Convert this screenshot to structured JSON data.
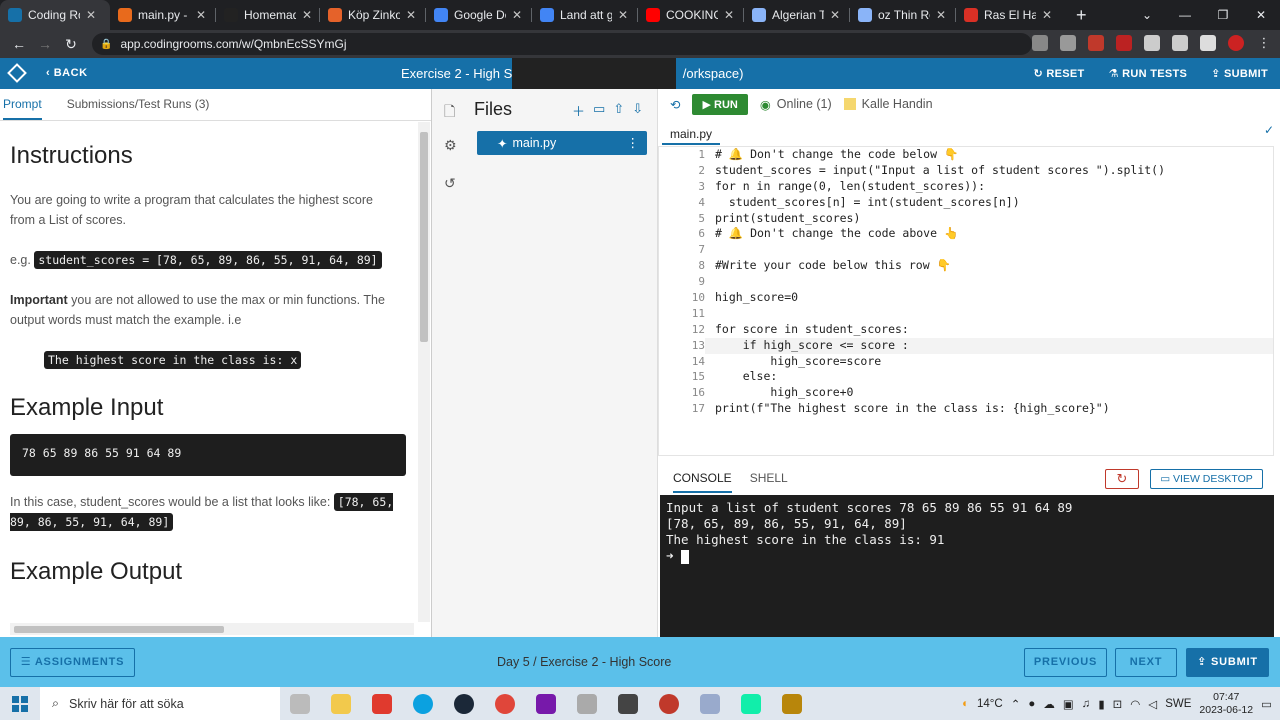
{
  "browser": {
    "tabs": [
      {
        "title": "Coding Ro...",
        "color": "#1670a8",
        "active": true
      },
      {
        "title": "main.py - p...",
        "color": "#e86a1c"
      },
      {
        "title": "Homemade...",
        "color": "#222222"
      },
      {
        "title": "Köp Zinkox...",
        "color": "#e5622a"
      },
      {
        "title": "Google Dok...",
        "color": "#4285f4"
      },
      {
        "title": "Land att gö...",
        "color": "#4285f4"
      },
      {
        "title": "COOKING /...",
        "color": "#ff0000"
      },
      {
        "title": "Algerian Th...",
        "color": "#8ab4f8"
      },
      {
        "title": "oz Thin Ro...",
        "color": "#8ab4f8"
      },
      {
        "title": "Ras El Han...",
        "color": "#d93025"
      }
    ],
    "new_tab": "+",
    "url": "app.codingrooms.com/w/QmbnEcSSYmGj"
  },
  "app_header": {
    "back": "BACK",
    "title": "Exercise 2 - High Sc",
    "title_tail": "/orkspace)",
    "reset": "RESET",
    "run_tests": "RUN TESTS",
    "submit": "SUBMIT"
  },
  "left_panel": {
    "tabs": [
      "Prompt",
      "Submissions/Test Runs (3)"
    ],
    "instructions_title": "Instructions",
    "intro": "You are going to write a program that calculates the highest score from a List of scores.",
    "eg_prefix": "e.g.",
    "eg_code": "student_scores = [78, 65, 89, 86, 55, 91, 64, 89]",
    "important_bold": "Important",
    "important_rest": " you are not allowed to use the max or min functions. The output words must match the example. i.e",
    "output_example": "The highest score in the class is: x",
    "example_input_title": "Example Input",
    "example_input": "78 65 89 86 55 91 64 89",
    "case_text": "In this case, student_scores would be a list that looks like: ",
    "case_code": "[78, 65, 89, 86, 55, 91, 64, 89]",
    "example_output_title": "Example Output"
  },
  "files": {
    "title": "Files",
    "file": "main.py"
  },
  "editor": {
    "run": "RUN",
    "online": "Online (1)",
    "user": "Kalle Handin",
    "tab": "main.py",
    "lines": [
      "# 🔔 Don't change the code below 👇",
      "student_scores = input(\"Input a list of student scores \").split()",
      "for n in range(0, len(student_scores)):",
      "  student_scores[n] = int(student_scores[n])",
      "print(student_scores)",
      "# 🔔 Don't change the code above 👆",
      "",
      "#Write your code below this row 👇",
      "",
      "high_score=0",
      "",
      "for score in student_scores:",
      "    if high_score <= score :",
      "        high_score=score",
      "    else:",
      "        high_score+0",
      "print(f\"The highest score in the class is: {high_score}\")"
    ],
    "line_numbers": [
      "1",
      "2",
      "3",
      "4",
      "5",
      "6",
      "7",
      "8",
      "9",
      "10",
      "11",
      "12",
      "13",
      "14",
      "15",
      "16",
      "17"
    ]
  },
  "console": {
    "tabs": [
      "CONSOLE",
      "SHELL"
    ],
    "view_desktop": "VIEW DESKTOP",
    "output": [
      "Input a list of student scores 78 65 89 86 55 91 64 89",
      "[78, 65, 89, 86, 55, 91, 64, 89]",
      "The highest score in the class is: 91"
    ],
    "prompt": "➜"
  },
  "bottom_bar": {
    "assignments": "ASSIGNMENTS",
    "crumb": "Day 5 / Exercise 2 - High Score",
    "previous": "PREVIOUS",
    "next": "NEXT",
    "submit": "SUBMIT"
  },
  "taskbar": {
    "search_placeholder": "Skriv här för att söka",
    "weather": "14°C",
    "lang": "SWE",
    "time": "07:47",
    "date": "2023-06-12"
  },
  "colors": {
    "brand_blue": "#1670a8",
    "bottom_bar": "#5bc0ea",
    "run_green": "#2e8a32"
  }
}
